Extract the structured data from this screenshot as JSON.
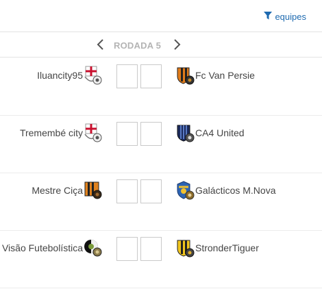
{
  "header": {
    "filter_label": "equipes",
    "filter_icon": "funnel-icon",
    "accent": "#1e6ab0"
  },
  "round": {
    "label": "RODADA 5",
    "prev_icon": "chevron-left-icon",
    "next_icon": "chevron-right-icon"
  },
  "matches": [
    {
      "home": "Iluancity95",
      "away": "Fc Van Persie",
      "home_score": "",
      "away_score": ""
    },
    {
      "home": "Tremembé city",
      "away": "CA4 United",
      "home_score": "",
      "away_score": ""
    },
    {
      "home": "Mestre Ciça",
      "away": "Galácticos M.Nova",
      "home_score": "",
      "away_score": ""
    },
    {
      "home": "Visão Futebolística",
      "away": "StronderTiguer",
      "home_score": "",
      "away_score": ""
    }
  ]
}
